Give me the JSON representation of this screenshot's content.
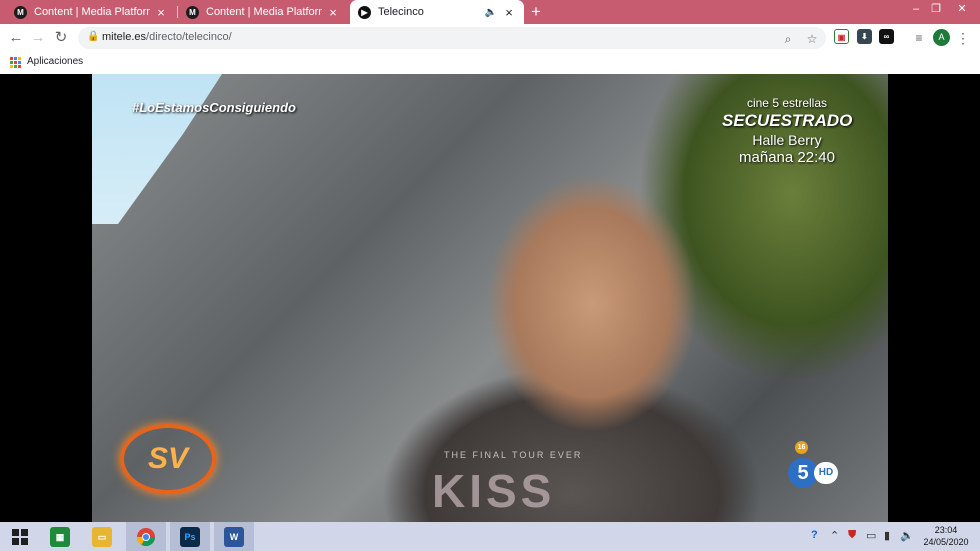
{
  "browser": {
    "tabs": [
      {
        "title": "Content | Media Platform",
        "favicon": "M",
        "active": false
      },
      {
        "title": "Content | Media Platform",
        "favicon": "M",
        "active": false
      },
      {
        "title": "Telecinco",
        "favicon": "play",
        "active": true
      }
    ],
    "new_tab": "+",
    "url_host": "mitele.es",
    "url_path": "/directo/telecinco/",
    "profile_initial": "A",
    "bookmarks_apps_label": "Aplicaciones"
  },
  "video": {
    "hashtag": "#LoEstamosConsiguiendo",
    "promo_line1": "cine 5 estrellas",
    "promo_line2": "SECUESTRADO",
    "promo_line3": "Halle Berry",
    "promo_line4": "mañana 22:40",
    "show_logo": "SV",
    "age_rating": "16",
    "channel_number": "5",
    "channel_hd": "HD",
    "shirt_text": "THE FINAL TOUR EVER",
    "shirt_logo": "KISS"
  },
  "taskbar": {
    "apps": [
      {
        "name": "Store",
        "label": "",
        "color": "#1f8a3a"
      },
      {
        "name": "File Explorer",
        "label": "",
        "color": "#e8b530"
      },
      {
        "name": "Chrome",
        "label": "",
        "color": "#db4437"
      },
      {
        "name": "Photoshop",
        "label": "Ps",
        "color": "#0b2a4a"
      },
      {
        "name": "Word",
        "label": "W",
        "color": "#2b579a"
      }
    ],
    "time": "23:04",
    "date": "24/05/2020"
  },
  "colors": {
    "tabstrip": "#c75b6f",
    "taskbar": "#d1d6e8"
  }
}
